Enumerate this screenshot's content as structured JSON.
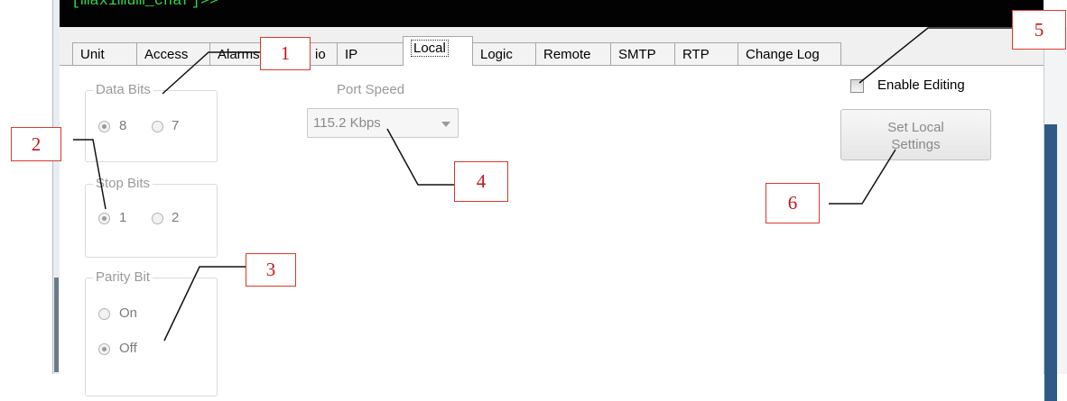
{
  "terminal": {
    "text": "[maximum_char]>>"
  },
  "tabs": [
    {
      "label": "Unit"
    },
    {
      "label": "Access"
    },
    {
      "label": "Alarms"
    },
    {
      "label": "io"
    },
    {
      "label": "IP"
    },
    {
      "label": "Local",
      "active": true
    },
    {
      "label": "Logic"
    },
    {
      "label": "Remote"
    },
    {
      "label": "SMTP"
    },
    {
      "label": "RTP"
    },
    {
      "label": "Change Log"
    }
  ],
  "data_bits": {
    "title": "Data Bits",
    "options": [
      "8",
      "7"
    ],
    "selected": "8"
  },
  "stop_bits": {
    "title": "Stop Bits",
    "options": [
      "1",
      "2"
    ],
    "selected": "1"
  },
  "parity_bit": {
    "title": "Parity Bit",
    "options": [
      "On",
      "Off"
    ],
    "selected": "Off"
  },
  "port_speed": {
    "label": "Port Speed",
    "value": "115.2 Kbps"
  },
  "enable_editing": {
    "label": "Enable Editing",
    "checked": false
  },
  "set_local_button": {
    "line1": "Set Local",
    "line2": "Settings"
  },
  "callouts": [
    "1",
    "2",
    "3",
    "4",
    "5",
    "6"
  ],
  "colors": {
    "terminal_bg": "#020202",
    "terminal_text": "#2fd84a",
    "callout": "#c0181a",
    "scroll_thumb": "#2f5a86"
  }
}
